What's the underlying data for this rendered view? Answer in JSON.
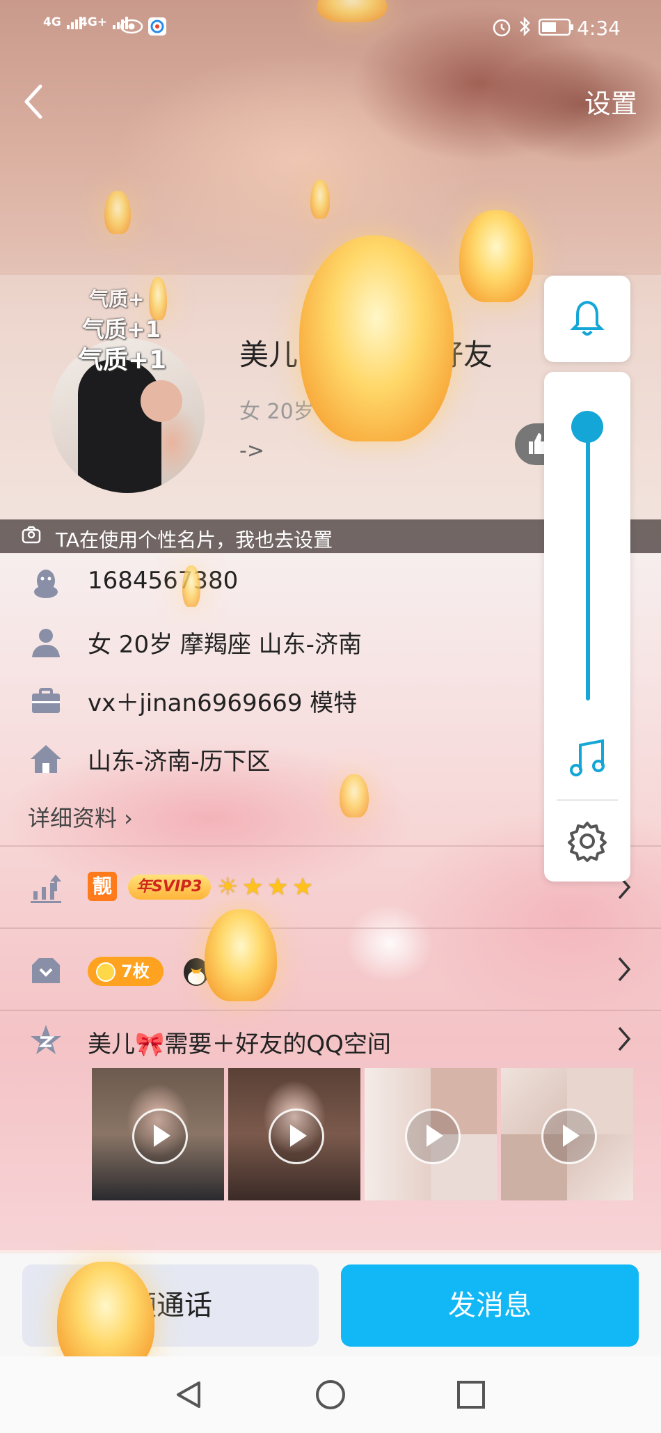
{
  "status_bar": {
    "signal_1": "4G",
    "signal_2": "4G+",
    "time": "4:34"
  },
  "nav": {
    "back_icon": "chevron-left-icon",
    "settings_label": "设置"
  },
  "profile": {
    "tags": [
      "气质+",
      "气质+1",
      "气质+1"
    ],
    "nickname_left": "美儿",
    "nickname_right": "好友",
    "subinfo": "女 20岁",
    "link_arrow": "->",
    "like_icon": "thumbs-up-icon"
  },
  "banner": {
    "icon": "card-icon",
    "text": "TA在使用个性名片，我也去设置"
  },
  "info_rows": [
    {
      "icon": "penguin-icon",
      "text": "1684567380"
    },
    {
      "icon": "person-icon",
      "text": "女  20岁  摩羯座  山东-济南"
    },
    {
      "icon": "briefcase-icon",
      "text": "vx＋jinan6969669 模特"
    },
    {
      "icon": "home-icon",
      "text": "山东-济南-历下区"
    }
  ],
  "detail_link": "详细资料 ›",
  "vip_row": {
    "liang_badge": "靓",
    "svip_badge": "年SVIP3",
    "stars": [
      "☀",
      "★",
      "★",
      "★"
    ]
  },
  "medal_row": {
    "coin_count": "7枚"
  },
  "zone_row": {
    "title": "美儿🎀需要＋好友的QQ空间",
    "thumbnails": [
      "video-1",
      "video-2",
      "video-3",
      "video-4"
    ]
  },
  "bottom_buttons": {
    "video_call": "频通话",
    "send_message": "发消息"
  },
  "colors": {
    "accent": "#12b7f5",
    "slider": "#14a6d6",
    "vip_orange": "#ff7a1a"
  }
}
